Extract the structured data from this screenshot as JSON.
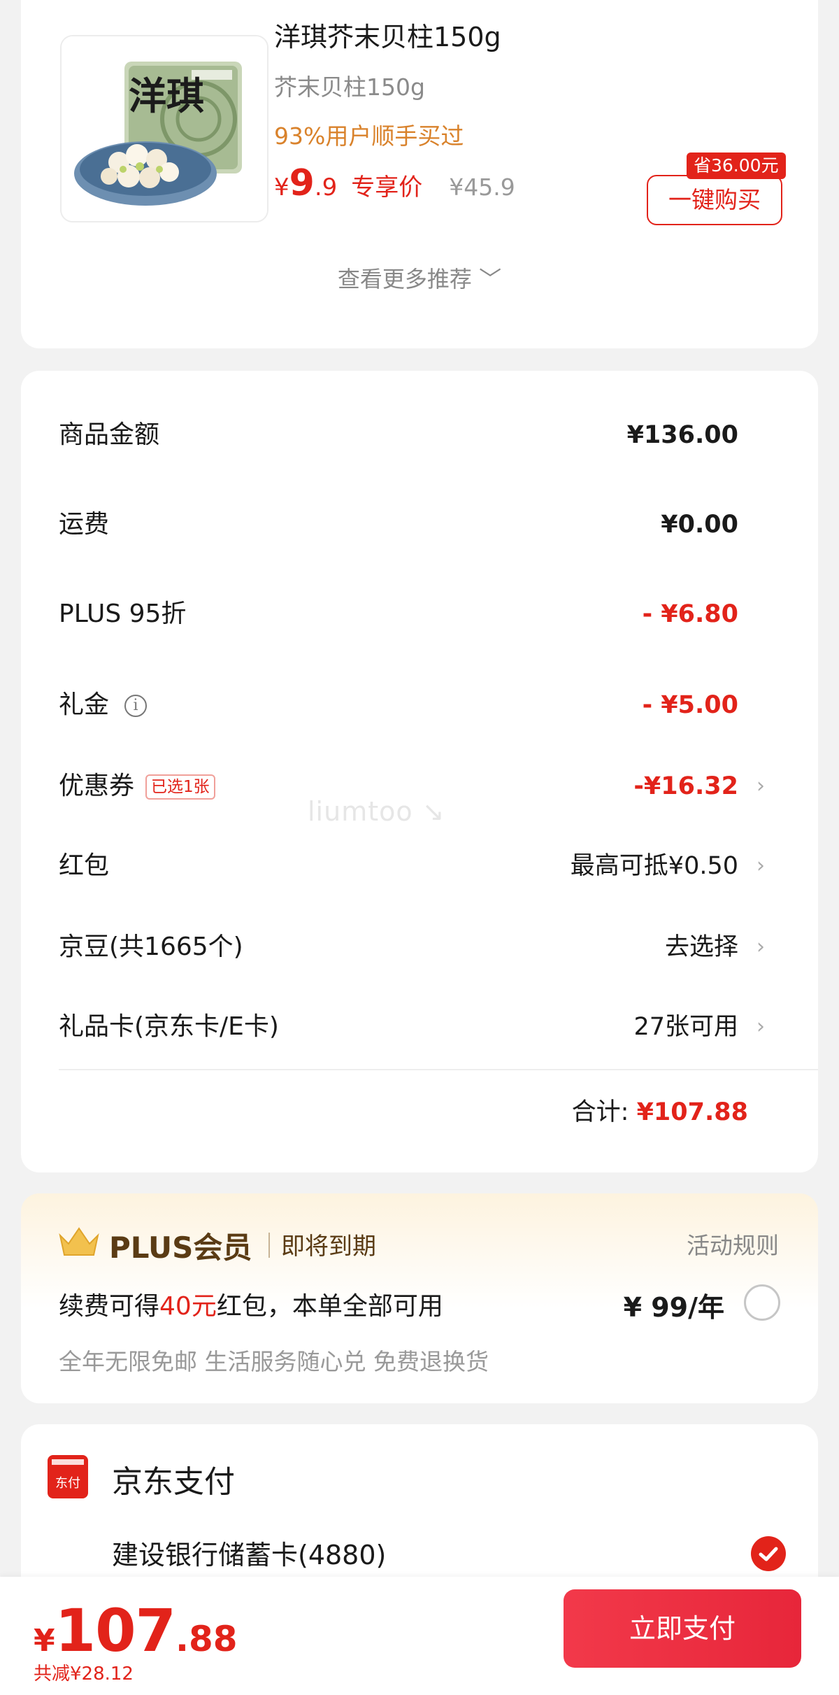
{
  "product": {
    "title": "洋琪芥末贝柱150g",
    "subtitle": "芥末贝柱150g",
    "buyers": "93%用户顺手买过",
    "price_symbol": "¥",
    "price_int": "9",
    "price_dec": ".9",
    "exclusive_label": "专享价",
    "original_price": "¥45.9",
    "save_badge": "省36.00元",
    "buy_button": "一键购买",
    "package_text": "洋琪",
    "more_recommend": "查看更多推荐 ﹀"
  },
  "summary": {
    "rows": [
      {
        "label": "商品金额",
        "value": "¥136.00"
      },
      {
        "label": "运费",
        "value": "¥0.00"
      },
      {
        "label": "PLUS 95折",
        "value": "- ¥6.80"
      },
      {
        "label": "礼金",
        "value": "- ¥5.00",
        "info_icon": "i"
      },
      {
        "label": "优惠券",
        "tag": "已选1张",
        "value": "-¥16.32"
      },
      {
        "label": "红包",
        "value": "最高可抵¥0.50"
      },
      {
        "label": "京豆(共1665个)",
        "value": "去选择"
      },
      {
        "label": "礼品卡(京东卡/E卡)",
        "value": "27张可用"
      }
    ],
    "total_label": "合计:",
    "total_value": "¥107.88",
    "chevron": "›"
  },
  "watermark": "liumtoo ↘",
  "plus": {
    "title": "PLUS会员",
    "status": "即将到期",
    "rules": "活动规则",
    "desc_prefix": "续费可得",
    "desc_highlight": "40元",
    "desc_suffix": "红包，本单全部可用",
    "price": "¥ 99/年",
    "benefits": "全年无限免邮 生活服务随心兑 免费退换货"
  },
  "payment": {
    "title": "京东支付",
    "icon_text": "东付",
    "card": "建设银行储蓄卡(4880)"
  },
  "bottom_bar": {
    "yen": "¥",
    "int": "107",
    "dec": ".88",
    "saved": "共减¥28.12",
    "pay_button": "立即支付"
  },
  "colors": {
    "accent": "#e2231a",
    "plus_brown": "#5a3b14",
    "orange": "#d9822b"
  }
}
